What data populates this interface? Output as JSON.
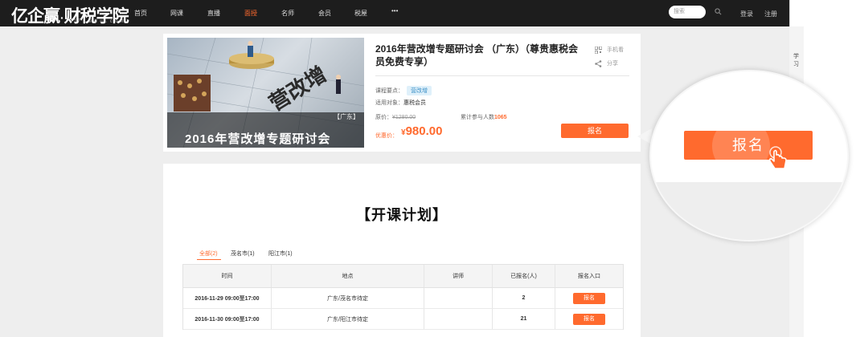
{
  "nav": {
    "logo": "亿企赢",
    "logo_dot": "·",
    "logo_brand": "财税学院",
    "logo_url": "17 1 e d u . c o m",
    "items": [
      "首页",
      "网课",
      "直播",
      "面授",
      "名师",
      "会员",
      "税屋",
      "•••"
    ],
    "active_index": 3,
    "search_placeholder": "搜索",
    "login": "登录",
    "register": "注册"
  },
  "course": {
    "banner_tag": "【广东】",
    "banner_title": "2016年营改增专题研讨会",
    "title": "2016年营改增专题研讨会 （广东）（尊贵惠税会员免费专享）",
    "mobile_view": "手机看",
    "share": "分享",
    "key_label": "课程要点：",
    "key_tag": "营改增",
    "target_label": "适用对象：",
    "target_value": "惠税会员",
    "original_label": "原价：",
    "original_price": "¥1280.00",
    "participants_label": "累计参与人数",
    "participants_count": "1065",
    "promo_label": "优惠价：",
    "currency": "¥",
    "promo_price": "980.00",
    "register_button": "报名"
  },
  "plan": {
    "title": "【开课计划】",
    "filters": [
      "全部(2)",
      "茂名市(1)",
      "阳江市(1)"
    ],
    "columns": [
      "时间",
      "地点",
      "讲师",
      "已报名(人)",
      "报名入口"
    ],
    "rows": [
      {
        "time": "2016-11-29 09:00至17:00",
        "place": "广东/茂名市待定",
        "teacher": "",
        "enrolled": "2",
        "action": "报名"
      },
      {
        "time": "2016-11-30 09:00至17:00",
        "place": "广东/阳江市待定",
        "teacher": "",
        "enrolled": "21",
        "action": "报名"
      }
    ]
  },
  "side_strip": "学习",
  "magnifier": {
    "button": "报名"
  },
  "colors": {
    "accent": "#ff6a2e",
    "nav_bg": "#1d1d1d",
    "tag_bg": "#dff0fa",
    "tag_text": "#3a8fc6"
  }
}
